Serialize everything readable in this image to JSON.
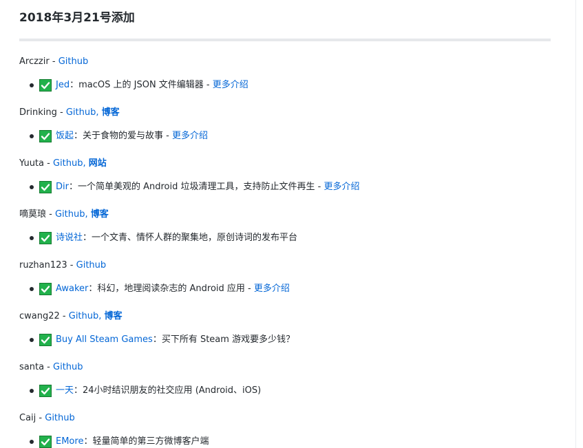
{
  "page": {
    "title": "2018年3月21号添加"
  },
  "entries": [
    {
      "author": "Arczzir",
      "sep": " - ",
      "links": [
        {
          "label": "Github",
          "bold": false
        }
      ],
      "app": {
        "name": "Jed",
        "desc": "：macOS 上的 JSON 文件编辑器 - ",
        "more": "更多介绍"
      }
    },
    {
      "author": "Drinking",
      "sep": " - ",
      "links": [
        {
          "label": "Github",
          "bold": false
        },
        {
          "label": "博客",
          "bold": true
        }
      ],
      "app": {
        "name": "饭起",
        "desc": "：关于食物的爱与故事 - ",
        "more": "更多介绍"
      }
    },
    {
      "author": "Yuuta",
      "sep": " - ",
      "links": [
        {
          "label": "Github",
          "bold": false
        },
        {
          "label": "网站",
          "bold": true
        }
      ],
      "app": {
        "name": "Dir",
        "desc": "：一个简单美观的 Android 垃圾清理工具，支持防止文件再生 - ",
        "more": "更多介绍"
      }
    },
    {
      "author": "嘀莫琅",
      "sep": " - ",
      "links": [
        {
          "label": "Github",
          "bold": false
        },
        {
          "label": "博客",
          "bold": true
        }
      ],
      "app": {
        "name": "诗说社",
        "desc": "：一个文青、情怀人群的聚集地，原创诗词的发布平台",
        "more": ""
      }
    },
    {
      "author": "ruzhan123",
      "sep": " - ",
      "links": [
        {
          "label": "Github",
          "bold": false
        }
      ],
      "app": {
        "name": "Awaker",
        "desc": "：科幻，地理阅读杂志的 Android 应用 - ",
        "more": "更多介绍"
      }
    },
    {
      "author": "cwang22",
      "sep": " - ",
      "links": [
        {
          "label": "Github",
          "bold": false
        },
        {
          "label": "博客",
          "bold": true
        }
      ],
      "app": {
        "name": "Buy All Steam Games",
        "desc": "：买下所有 Steam 游戏要多少钱？",
        "more": ""
      }
    },
    {
      "author": "santa",
      "sep": " - ",
      "links": [
        {
          "label": "Github",
          "bold": false
        }
      ],
      "app": {
        "name": "一天",
        "desc": "：24小时结识朋友的社交应用 (Android、iOS)",
        "more": ""
      }
    },
    {
      "author": "Caij",
      "sep": " - ",
      "links": [
        {
          "label": "Github",
          "bold": false
        }
      ],
      "app": {
        "name": "EMore",
        "desc": "：轻量简单的第三方微博客户端",
        "more": ""
      }
    }
  ],
  "colors": {
    "link": "#0366d6",
    "text": "#24292e",
    "check_green": "#22b14c",
    "rule": "#e6e8eb"
  },
  "icons": {
    "check": "white-check-mark-icon",
    "bullet": "bullet-dot"
  }
}
